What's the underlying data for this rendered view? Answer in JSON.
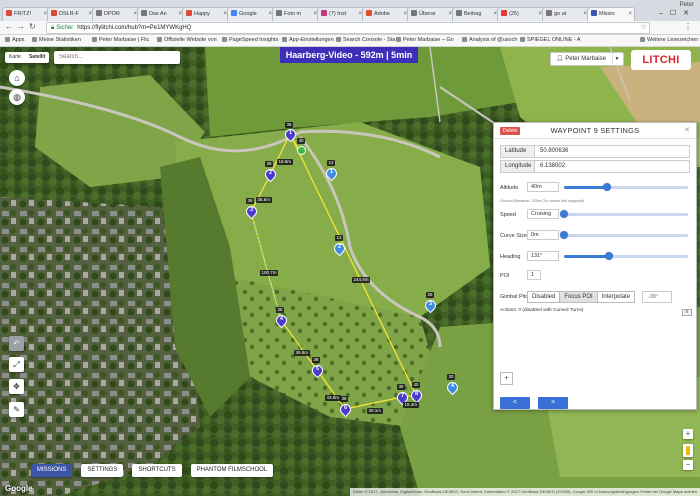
{
  "browser": {
    "user_name": "Peter",
    "tabs": [
      {
        "label": "FRITZ!",
        "color": "#d94b3b"
      },
      {
        "label": "DSLR-F",
        "color": "#d94b3b"
      },
      {
        "label": "DPOR",
        "color": "#777777"
      },
      {
        "label": "Das An",
        "color": "#777777"
      },
      {
        "label": "Happy",
        "color": "#e0483a"
      },
      {
        "label": "Google",
        "color": "#4285f4"
      },
      {
        "label": "Foto m",
        "color": "#777777"
      },
      {
        "label": "(7) Inst",
        "color": "#c13584"
      },
      {
        "label": "Adobe",
        "color": "#e34f26"
      },
      {
        "label": "Überar",
        "color": "#777777"
      },
      {
        "label": "Beitrag",
        "color": "#777777"
      },
      {
        "label": "(25)",
        "color": "#e53935"
      },
      {
        "label": "go at",
        "color": "#777777"
      },
      {
        "label": "Missio",
        "color": "#3d55a6"
      }
    ],
    "address": {
      "secure_label": "Sicher",
      "url": "https://flylitchi.com/hub?m=Pe1MYWKgHQ"
    },
    "bookmarks": [
      "Apps",
      "Meine Statistiken",
      "Peter Marbaise | Flic",
      "Offizielle Website von",
      "PageSpeed Insights",
      "App-Einstellungen",
      "Search Console - Sta",
      "Peter Marbaise – Go",
      "Analysis of @usoch",
      "SPIEGEL ONLINE - A",
      "Weitere Lesezeichen"
    ]
  },
  "map": {
    "maptype": {
      "map_label": "Karte",
      "satellite_label": "Satellit"
    },
    "search_placeholder": "Search...",
    "mission_title": "Haarberg-Video - 592m | 5min",
    "user_button": "Peter Marbaise",
    "logo": "LITCHI",
    "waypoints": [
      {
        "num": "1",
        "alt": "36"
      },
      {
        "num": "2",
        "alt": "38"
      },
      {
        "num": "3",
        "alt": "38"
      },
      {
        "num": "4",
        "alt": "38"
      },
      {
        "num": "5",
        "alt": "38"
      },
      {
        "num": "6",
        "alt": "38"
      },
      {
        "num": "7",
        "alt": "38"
      },
      {
        "num": "8",
        "alt": "40"
      }
    ],
    "home_alt": "40",
    "pois": [
      {
        "num": "1",
        "alt": "12"
      },
      {
        "num": "2",
        "alt": "12"
      },
      {
        "num": "3",
        "alt": "26"
      },
      {
        "num": "4",
        "alt": "30"
      }
    ],
    "segment_labels": [
      "18.6m",
      "36.6m",
      "100.7m",
      "39.8m",
      "43.8m",
      "30.1m",
      "15.4m",
      "244.9m"
    ],
    "bottom_tabs": [
      "MISSIONS",
      "SETTINGS",
      "SHORTCUTS",
      "PHANTOM FILMSCHOOL"
    ],
    "google_label": "Google",
    "attribution": "Bilder © 2017 , AeroWest, DigitalGlobe, GeoBasis-DE/BKG, GeoContent, Kartendaten © 2017 GeoBasis-DE/BKG (©2009), Google   200 m   Nutzungsbedingungen   Fehler bei Google Maps melden"
  },
  "panel": {
    "delete_label": "Delete",
    "title": "WAYPOINT 9 SETTINGS",
    "latitude_label": "Latitude",
    "latitude_value": "50.800636",
    "longitude_label": "Longitude",
    "longitude_value": "6.138002",
    "altitude_label": "Altitude",
    "altitude_value": "40m",
    "altitude_slider": 0.35,
    "elevation_note": "Ground Elevation: 225m (7m above first waypoint)",
    "speed_label": "Speed",
    "speed_value": "Cruising",
    "speed_slider": 0.0,
    "curve_label": "Curve Size",
    "curve_value": "0m",
    "curve_slider": 0.0,
    "heading_label": "Heading",
    "heading_value": "131°",
    "heading_slider": 0.36,
    "poi_label": "POI",
    "poi_value": "1",
    "pitch_label": "Gimbal Pitch",
    "pitch_options": [
      "Disabled",
      "Focus POI",
      "Interpolate"
    ],
    "pitch_selected": "Focus POI",
    "pitch_value": "-38°",
    "actions_label": "Actions: 0 (disabled with Curved Turns)",
    "add_label": "+",
    "prev_label": "<",
    "next_label": ">"
  }
}
